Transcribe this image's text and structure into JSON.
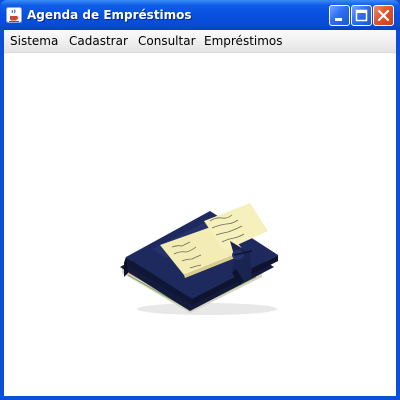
{
  "window": {
    "title": "Agenda de Empréstimos",
    "app_icon": "java-cup-icon"
  },
  "title_buttons": {
    "minimize_icon": "minimize-icon",
    "maximize_icon": "maximize-icon",
    "close_icon": "close-icon"
  },
  "menu": {
    "items": [
      {
        "label": "Sistema"
      },
      {
        "label": "Cadastrar"
      },
      {
        "label": "Consultar"
      },
      {
        "label": "Empréstimos"
      }
    ]
  },
  "content": {
    "image": "agenda-notebook-with-sticky-notes"
  },
  "colors": {
    "titlebar": "#0750e0",
    "close_button": "#e0552c",
    "menubar": "#eeeeee",
    "background": "#ffffff"
  }
}
